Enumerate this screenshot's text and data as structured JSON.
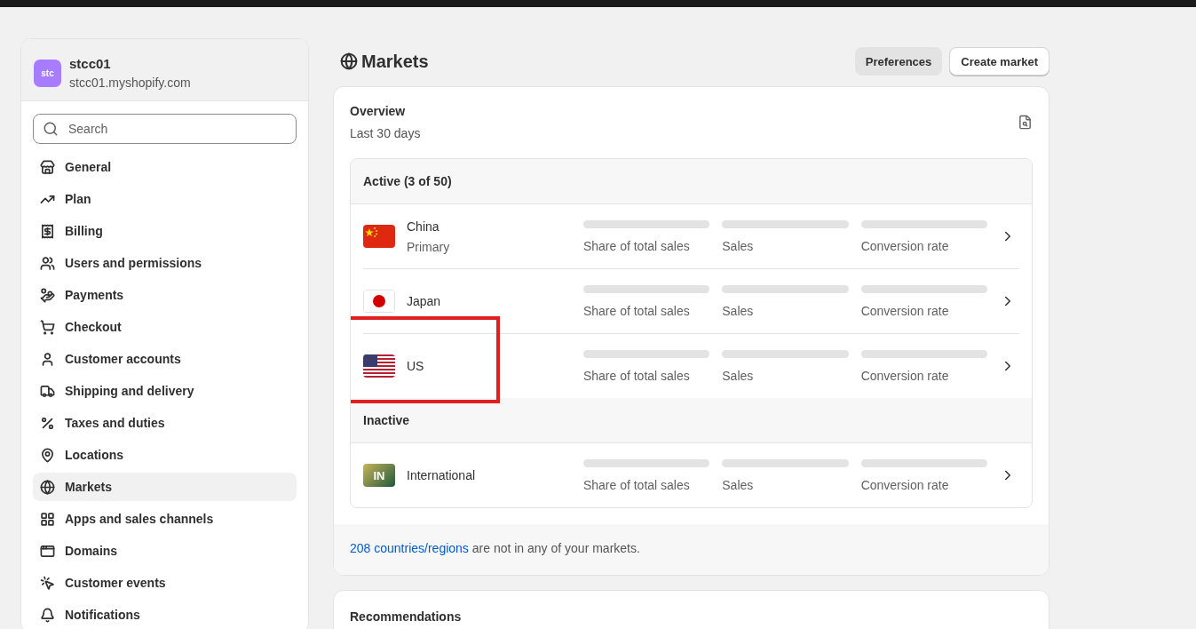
{
  "store": {
    "avatar": "stc",
    "name": "stcc01",
    "domain": "stcc01.myshopify.com"
  },
  "search": {
    "placeholder": "Search"
  },
  "sidebar": {
    "items": [
      {
        "label": "General",
        "selected": false
      },
      {
        "label": "Plan",
        "selected": false
      },
      {
        "label": "Billing",
        "selected": false
      },
      {
        "label": "Users and permissions",
        "selected": false
      },
      {
        "label": "Payments",
        "selected": false
      },
      {
        "label": "Checkout",
        "selected": false
      },
      {
        "label": "Customer accounts",
        "selected": false
      },
      {
        "label": "Shipping and delivery",
        "selected": false
      },
      {
        "label": "Taxes and duties",
        "selected": false
      },
      {
        "label": "Locations",
        "selected": false
      },
      {
        "label": "Markets",
        "selected": true
      },
      {
        "label": "Apps and sales channels",
        "selected": false
      },
      {
        "label": "Domains",
        "selected": false
      },
      {
        "label": "Customer events",
        "selected": false
      },
      {
        "label": "Notifications",
        "selected": false
      }
    ]
  },
  "page": {
    "title": "Markets",
    "buttons": [
      {
        "label": "Preferences",
        "kind": "secondary"
      },
      {
        "label": "Create market",
        "kind": "primary"
      }
    ]
  },
  "overview": {
    "title": "Overview",
    "subtitle": "Last 30 days",
    "groups": [
      {
        "heading": "Active (3 of 50)",
        "markets": [
          {
            "name": "China",
            "note": "Primary",
            "kind": "cn",
            "metrics": [
              "Share of total sales",
              "Sales",
              "Conversion rate"
            ],
            "highlighted": false
          },
          {
            "name": "Japan",
            "kind": "jp",
            "metrics": [
              "Share of total sales",
              "Sales",
              "Conversion rate"
            ],
            "highlighted": false
          },
          {
            "name": "US",
            "kind": "us",
            "metrics": [
              "Share of total sales",
              "Sales",
              "Conversion rate"
            ],
            "highlighted": true
          }
        ]
      },
      {
        "heading": "Inactive",
        "markets": [
          {
            "name": "International",
            "kind": "badge",
            "badge": "IN",
            "metrics": [
              "Share of total sales",
              "Sales",
              "Conversion rate"
            ],
            "highlighted": false
          }
        ]
      }
    ],
    "footer": {
      "link": "208 countries/regions",
      "text": " are not in any of your markets."
    }
  },
  "recommendations": {
    "title": "Recommendations"
  }
}
